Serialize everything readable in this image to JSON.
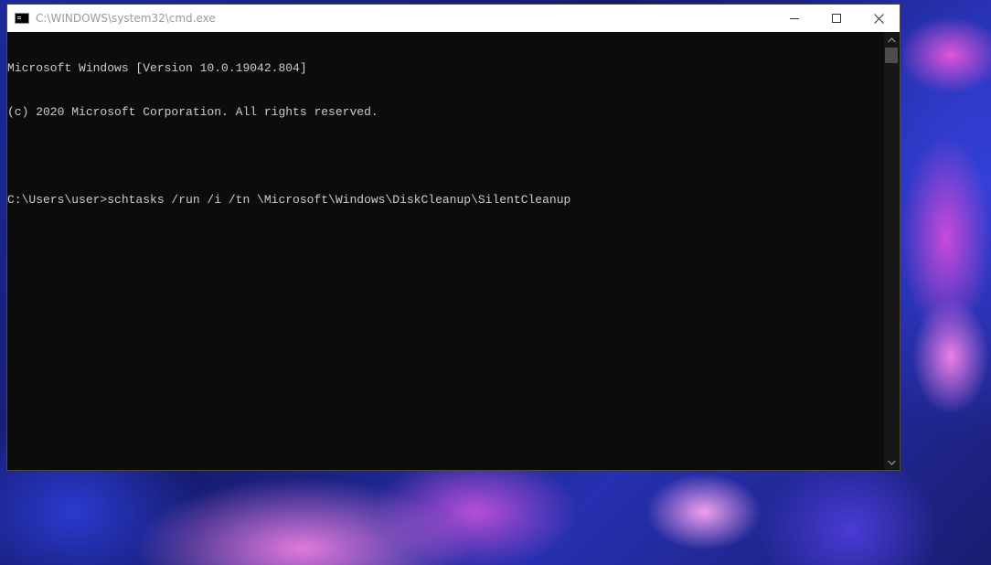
{
  "window": {
    "title": "C:\\WINDOWS\\system32\\cmd.exe",
    "icon": "cmd-icon"
  },
  "caption": {
    "minimize_icon": "minimize-icon",
    "maximize_icon": "maximize-icon",
    "close_icon": "close-icon"
  },
  "console": {
    "lines": [
      "Microsoft Windows [Version 10.0.19042.804]",
      "(c) 2020 Microsoft Corporation. All rights reserved.",
      "",
      "C:\\Users\\user>schtasks /run /i /tn \\Microsoft\\Windows\\DiskCleanup\\SilentCleanup"
    ],
    "background_color": "#0c0c0c",
    "text_color": "#cccccc"
  },
  "scrollbar": {
    "up_icon": "chevron-up-icon",
    "down_icon": "chevron-down-icon"
  }
}
